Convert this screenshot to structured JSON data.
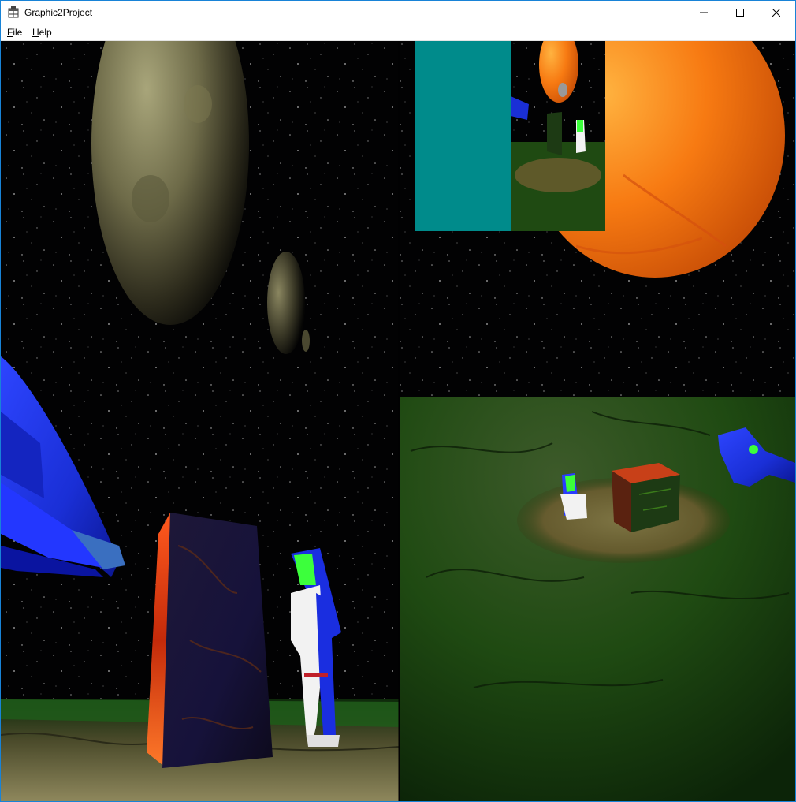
{
  "window": {
    "title": "Graphic2Project",
    "app_icon": "app-window-icon",
    "controls": [
      "minimize-icon",
      "maximize-icon",
      "close-icon"
    ]
  },
  "menu": {
    "file": {
      "accel": "F",
      "rest": "ile"
    },
    "help": {
      "accel": "H",
      "rest": "elp"
    }
  },
  "colors": {
    "title_border": "#1883d7",
    "minimap_teal": "#008b8b",
    "sun_orange": "#f77a12",
    "ground_green": "#1f4a12",
    "ship_blue": "#1a2fd6"
  },
  "scene": {
    "panes": [
      "main-3d-view",
      "second-camera-view",
      "minimap-view"
    ],
    "objects": [
      "planet",
      "moon",
      "sun",
      "spaceship",
      "lava-monolith",
      "lava-cube",
      "astronaut",
      "spotlight-ring",
      "star-field"
    ]
  }
}
